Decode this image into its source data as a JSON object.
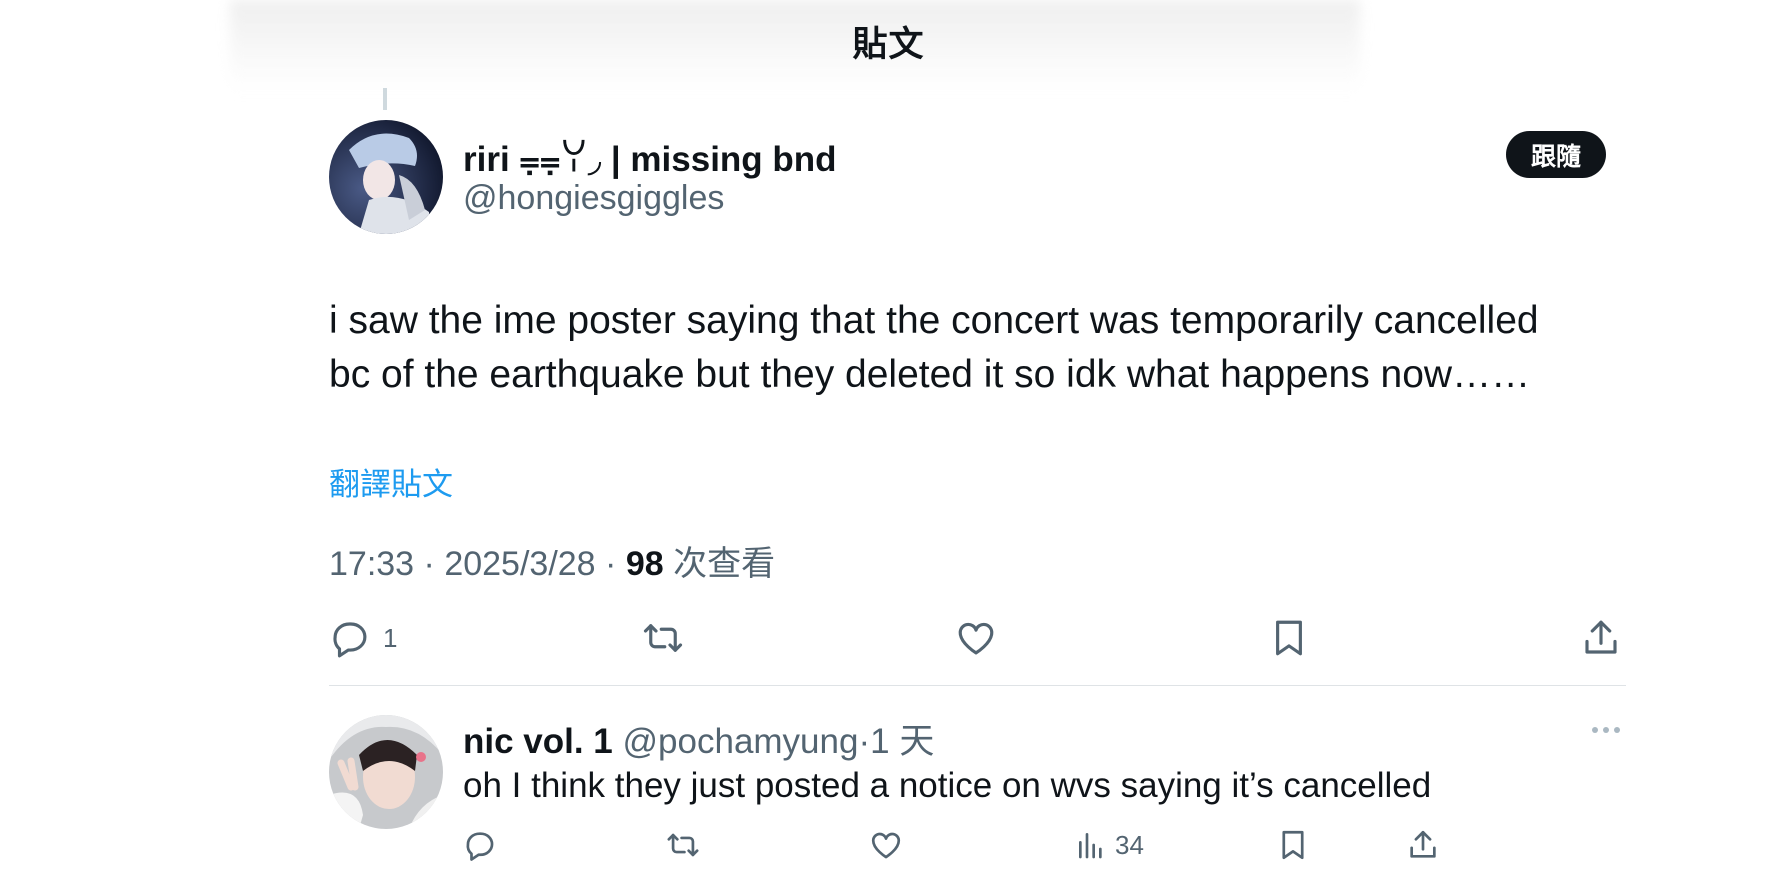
{
  "header": {
    "title": "貼文"
  },
  "post": {
    "author_name": "riri ⩦⩦ꌩ◞ | missing bnd",
    "author_handle": "@hongiesgiggles",
    "follow_label": "跟隨",
    "text_line1": "i saw the ime poster saying that the concert was temporarily cancelled",
    "text_line2": "bc of the earthquake but they deleted it so idk what happens now……",
    "translate_label": "翻譯貼文",
    "time": "17:33",
    "date": "2025/3/28",
    "sep": "·",
    "views_count": "98",
    "views_label": "次查看",
    "reply_count": "1"
  },
  "reply": {
    "author_name": "nic vol. 1",
    "author_handle": "@pochamyung",
    "sep": "·",
    "time": "1 天",
    "text": "oh I think they just posted a notice on wvs saying it’s cancelled",
    "views_count": "34"
  },
  "icons": {
    "reply": "reply-icon",
    "repost": "repost-icon",
    "like": "heart-icon",
    "bookmark": "bookmark-icon",
    "share": "share-icon",
    "views": "views-chart-icon",
    "more": "more-icon"
  },
  "colors": {
    "text_primary": "#0f1419",
    "text_secondary": "#536471",
    "link": "#1d9bf0",
    "follow_bg": "#0f1419"
  }
}
